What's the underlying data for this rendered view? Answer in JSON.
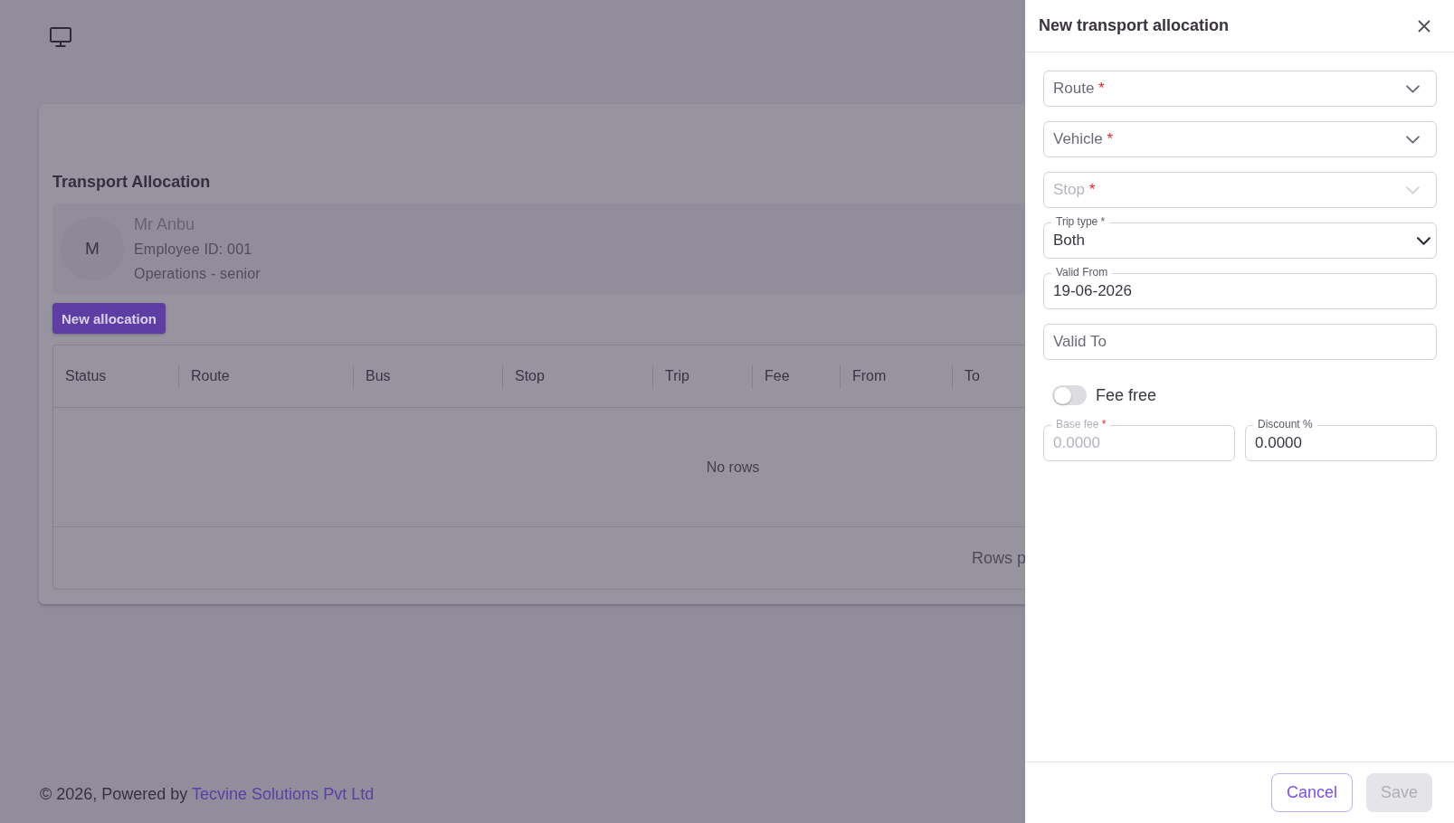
{
  "card": {
    "title": "Transport Allocation",
    "profile": {
      "initial": "M",
      "name": "Mr Anbu",
      "employee_id": "Employee ID: 001",
      "department": "Operations - senior"
    },
    "new_button": "New allocation",
    "table": {
      "columns": [
        "Status",
        "Route",
        "Bus",
        "Stop",
        "Trip",
        "Fee",
        "From",
        "To"
      ],
      "empty_message": "No rows",
      "footer_text": "Rows p"
    }
  },
  "footer": {
    "text": "© 2026, Powered by",
    "link": "Tecvine Solutions Pvt Ltd"
  },
  "drawer": {
    "title": "New transport allocation",
    "fields": [
      {
        "kind": "select",
        "label": "Route",
        "required_mark": "*",
        "disabled": false
      },
      {
        "kind": "select",
        "label": "Vehicle",
        "required_mark": "*",
        "disabled": false
      },
      {
        "kind": "select",
        "label": "Stop",
        "required_mark": "*",
        "disabled": true
      },
      {
        "kind": "native-select",
        "label": "Trip type *",
        "value": "Both",
        "disabled": false
      },
      {
        "kind": "date",
        "label": "Valid From",
        "value": "19-06-2026",
        "disabled": false
      },
      {
        "kind": "date",
        "label": "Valid To",
        "disabled": false
      }
    ],
    "fee_free": {
      "label": "Fee free",
      "on": false
    },
    "fee_fields": [
      {
        "kind": "number",
        "label": "Base fee",
        "required_mark": "*",
        "value": "0.0000",
        "disabled": true
      },
      {
        "kind": "number",
        "label": "Discount %",
        "value": "0.0000",
        "disabled": false
      }
    ],
    "buttons": [
      {
        "label": "Cancel",
        "kind": "outline",
        "disabled": false
      },
      {
        "label": "Save",
        "kind": "filled",
        "disabled": true
      }
    ]
  }
}
